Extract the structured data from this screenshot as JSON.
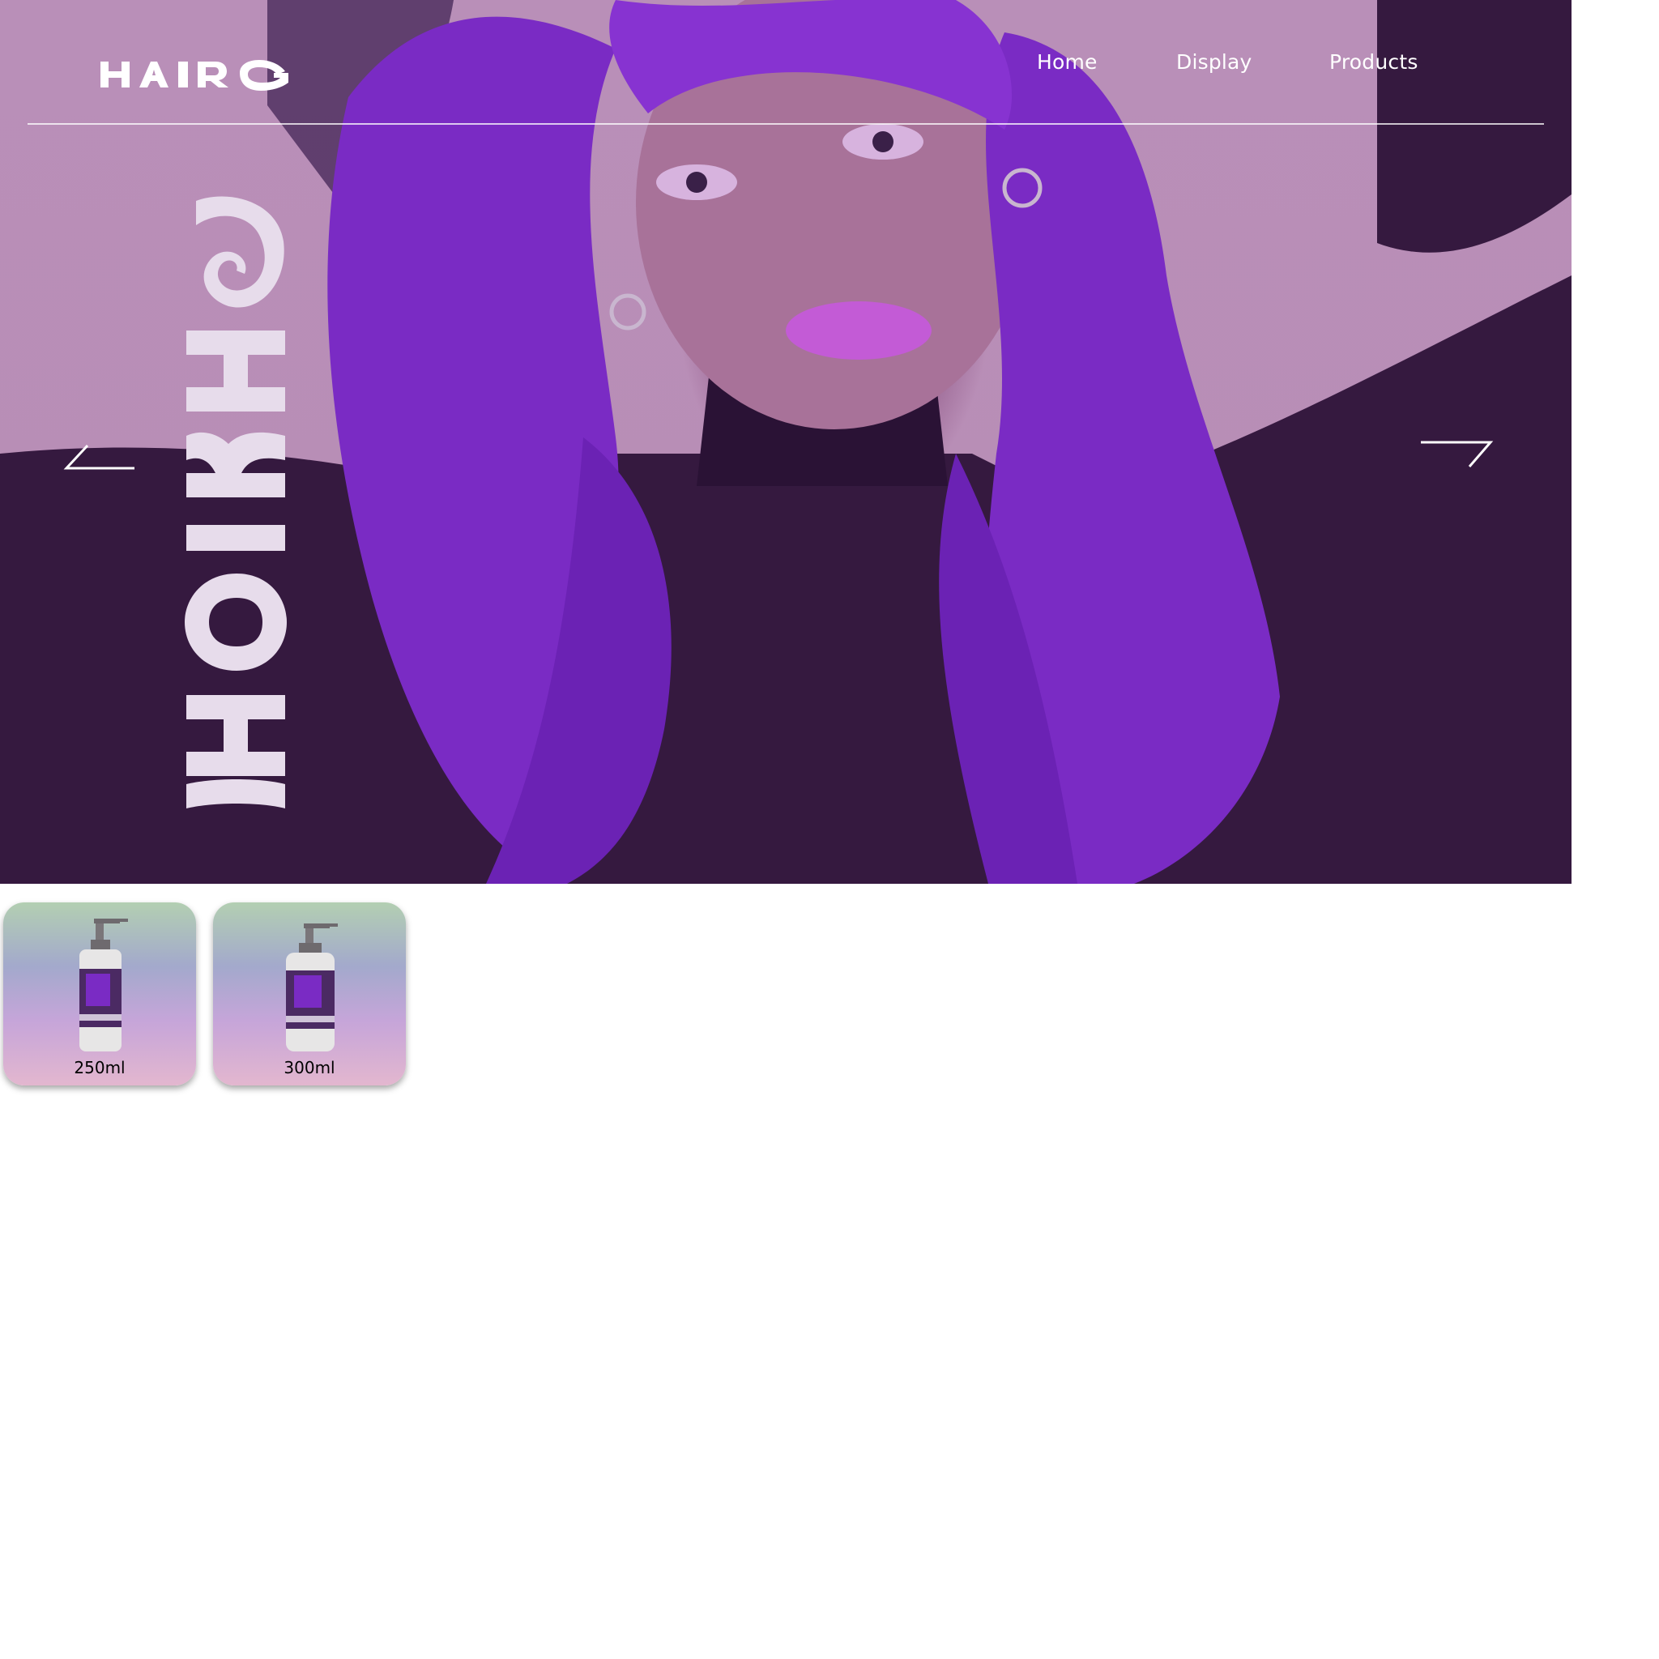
{
  "brand": {
    "logo_text": "HAIR",
    "vertical_text": "HAIR"
  },
  "nav": {
    "items": [
      {
        "label": "Home"
      },
      {
        "label": "Display"
      },
      {
        "label": "Products"
      }
    ]
  },
  "hero": {
    "image_subject": "model-with-purple-wavy-hair",
    "prev_icon": "arrow-left-icon",
    "next_icon": "arrow-right-icon"
  },
  "products": [
    {
      "size_label": "250ml",
      "icon": "pump-bottle-icon"
    },
    {
      "size_label": "300ml",
      "icon": "pump-bottle-icon"
    }
  ],
  "colors": {
    "hero_tint": "#b98fb8",
    "hair": "#7a2bc4",
    "sweater": "#2e1640",
    "text_light": "#ffffff",
    "card_top": "#b3cfb2",
    "card_mid": "#a3a9cc",
    "card_bottom": "#e3b7cf"
  }
}
